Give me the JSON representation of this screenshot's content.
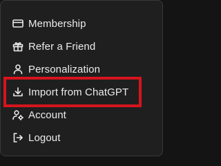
{
  "menu": {
    "items": [
      {
        "label": "Membership",
        "icon": "credit-card-icon"
      },
      {
        "label": "Refer a Friend",
        "icon": "gift-icon"
      },
      {
        "label": "Personalization",
        "icon": "user-icon"
      },
      {
        "label": "Import from ChatGPT",
        "icon": "download-icon"
      },
      {
        "label": "Account",
        "icon": "user-settings-icon"
      },
      {
        "label": "Logout",
        "icon": "logout-icon"
      }
    ]
  },
  "annotation": {
    "highlight_color": "#d6141e",
    "highlighted_item": "Import from ChatGPT"
  }
}
